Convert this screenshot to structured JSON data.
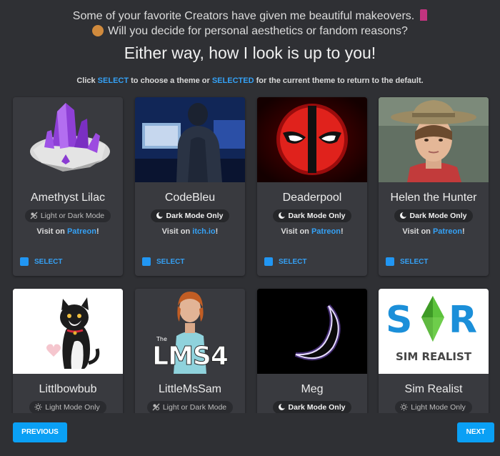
{
  "header": {
    "line1": "Some of your favorite Creators have given me beautiful makeovers.",
    "line2": "Will you decide for personal aesthetics or fandom reasons?",
    "line3": "Either way, how I look is up to you!",
    "instr_prefix": "Click",
    "instr_select": "SELECT",
    "instr_mid": "to choose a theme or",
    "instr_selected": "SELECTED",
    "instr_suffix": "for the current theme to return to the default."
  },
  "cards": [
    {
      "name": "Amethyst Lilac",
      "mode": "Light or Dark Mode",
      "visit_prefix": "Visit on",
      "link": "Patreon",
      "visit_suffix": "!",
      "select": "SELECT"
    },
    {
      "name": "CodeBleu",
      "mode": "Dark Mode Only",
      "visit_prefix": "Visit on",
      "link": "itch.io",
      "visit_suffix": "!",
      "select": "SELECT"
    },
    {
      "name": "Deaderpool",
      "mode": "Dark Mode Only",
      "visit_prefix": "Visit on",
      "link": "Patreon",
      "visit_suffix": "!",
      "select": "SELECT"
    },
    {
      "name": "Helen the Hunter",
      "mode": "Dark Mode Only",
      "visit_prefix": "Visit on",
      "link": "Patreon",
      "visit_suffix": "!",
      "select": "SELECT"
    },
    {
      "name": "Littlbowbub",
      "mode": "Light Mode Only"
    },
    {
      "name": "LittleMsSam",
      "mode": "Light or Dark Mode",
      "logo_text": "LMS4",
      "logo_small": "The"
    },
    {
      "name": "Meg",
      "mode": "Dark Mode Only"
    },
    {
      "name": "Sim Realist",
      "mode": "Light Mode Only",
      "logo_s": "S",
      "logo_r": "R",
      "logo_sub": "SIM REALIST"
    }
  ],
  "footer": {
    "prev": "PREVIOUS",
    "next": "NEXT"
  },
  "colors": {
    "accent": "#35a1f5",
    "button": "#0aa0f5",
    "card": "#393a3f",
    "background": "#2f3034"
  }
}
